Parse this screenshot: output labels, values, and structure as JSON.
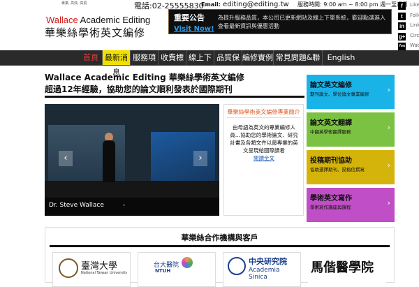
{
  "header": {
    "tagline": "專業, 高效, 高質",
    "brand_en_a": "Wallace",
    "brand_en_b": " Academic Editing",
    "brand_zh": "華樂絲學術英文編修",
    "phone": "電話:02-25555830",
    "email_label": "Email:",
    "email": "editing@editing.tw",
    "hours": "服務時間: 9:00 am ~ 8:00 pm 週一至週日",
    "notice": {
      "title": "重要公告",
      "link": "Visit Now!",
      "text": "為提升服務品質，本公司已更新網站及線上下單系統，歡迎點選進入查看最新資訊與優惠活動"
    },
    "social": [
      {
        "icon": "f",
        "label": "Like",
        "name": "facebook-icon"
      },
      {
        "icon": "t",
        "label": "Follow",
        "name": "twitter-icon"
      },
      {
        "icon": "in",
        "label": "LinkedIn",
        "name": "linkedin-icon"
      },
      {
        "icon": "g+",
        "label": "Circle",
        "name": "google-plus-icon"
      },
      {
        "icon": "You",
        "label": "Watch",
        "name": "youtube-icon"
      }
    ]
  },
  "nav": {
    "home": "首頁",
    "items": [
      "最新消息",
      "服務項目",
      "收費標準",
      "線上下單",
      "品質保證",
      "編修實例說明",
      "常見問題&聯絡我們",
      "English"
    ]
  },
  "main": {
    "headline_1": "Wallace Academic Editing 華樂絲學術英文編修",
    "headline_2": "超過12年經驗，協助您的論文順利發表於國際期刊",
    "slider": {
      "caption": "Dr. Steve Wallace",
      "caption_sep": "-",
      "prev": "‹",
      "next": "›"
    },
    "intro": {
      "title": "華樂絲學術英文編修專業簡介",
      "body": "由母語為英文的專業編修人員…協助您的學術論文、研究計畫及各類文件以最專業的英文呈現給國際讀者",
      "more": "閱讀全文"
    }
  },
  "sidebar": [
    {
      "title": "論文英文編修",
      "desc": "期刊論文、學位論文專業編修",
      "color": "#1ab3e8"
    },
    {
      "title": "論文英文翻譯",
      "desc": "中翻英學術翻譯服務",
      "color": "#7cc242"
    },
    {
      "title": "投稿期刊協助",
      "desc": "協助選擇期刊、投稿信撰寫",
      "color": "#d4b40a"
    },
    {
      "title": "學術英文寫作",
      "desc": "學術寫作講座與課程",
      "color": "#c04ec6"
    }
  ],
  "clients": {
    "title": "華樂絲合作機構與客戶",
    "logos": [
      {
        "text": "臺灣大學",
        "sub": "National Taiwan University",
        "name": "ntu-logo"
      },
      {
        "text": "台大醫院",
        "sub": "NTUH",
        "name": "ntuh-logo"
      },
      {
        "text": "中央研究院",
        "sub": "Academia Sinica",
        "name": "academia-sinica-logo"
      },
      {
        "text": "馬偕醫學院",
        "sub": "",
        "name": "mackay-logo"
      }
    ]
  }
}
